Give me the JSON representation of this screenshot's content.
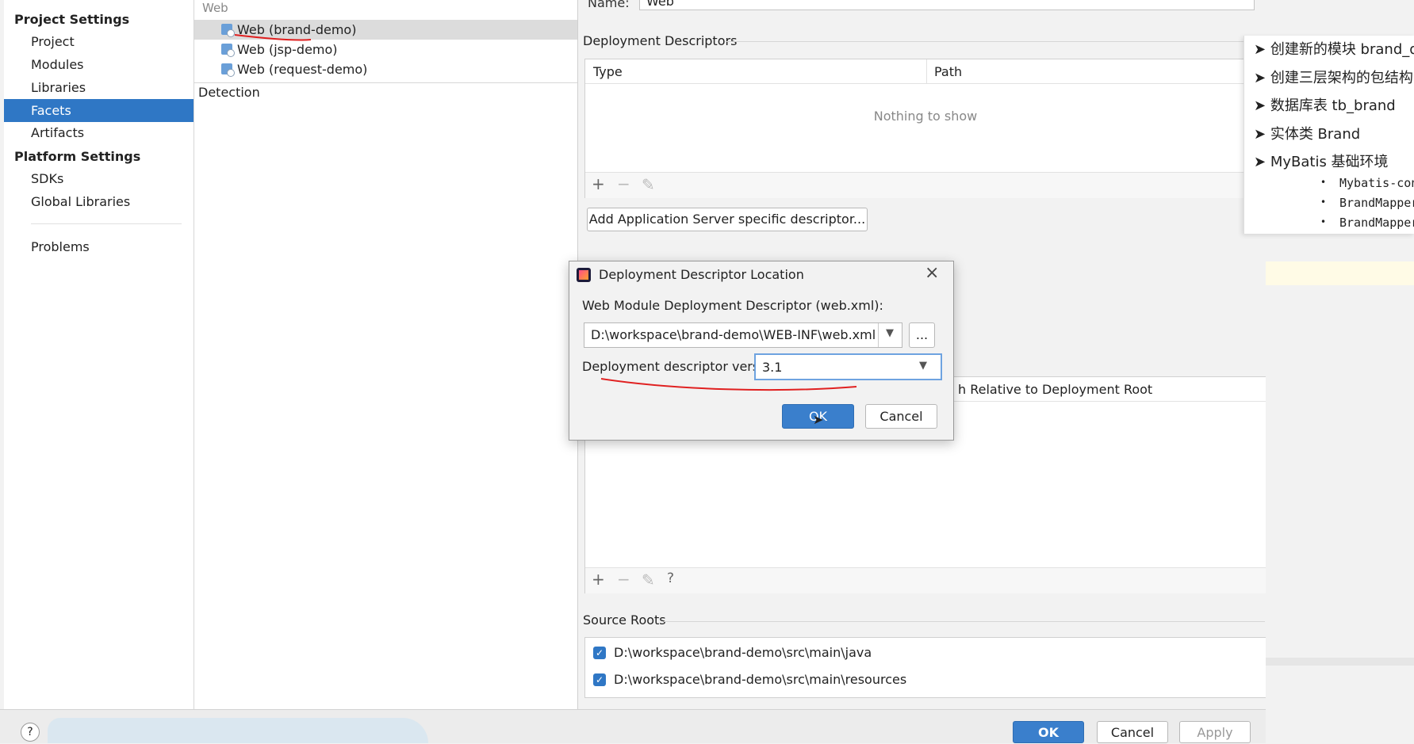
{
  "left_nav": {
    "project_settings_header": "Project Settings",
    "project_items": [
      "Project",
      "Modules",
      "Libraries",
      "Facets",
      "Artifacts"
    ],
    "platform_settings_header": "Platform Settings",
    "platform_items": [
      "SDKs",
      "Global Libraries"
    ],
    "problems": "Problems",
    "selected": "Facets"
  },
  "facets_tree": {
    "group": "Web",
    "items": [
      "Web (brand-demo)",
      "Web (jsp-demo)",
      "Web (request-demo)"
    ],
    "selected": "Web (brand-demo)",
    "detection": "Detection"
  },
  "facet_panel": {
    "name_label": "Name:",
    "name_value": "Web",
    "deployment_descriptors_title": "Deployment Descriptors",
    "columns": [
      "Type",
      "Path"
    ],
    "empty_text": "Nothing to show",
    "add_server_descriptor": "Add Application Server specific descriptor...",
    "web_resource_column_partial": "h Relative to Deployment Root",
    "source_roots_title": "Source Roots",
    "source_roots": [
      {
        "path": "D:\\workspace\\brand-demo\\src\\main\\java",
        "checked": true
      },
      {
        "path": "D:\\workspace\\brand-demo\\src\\main\\resources",
        "checked": true
      }
    ]
  },
  "dialog": {
    "title": "Deployment Descriptor Location",
    "descriptor_label": "Web Module Deployment Descriptor (web.xml):",
    "descriptor_path": "D:\\workspace\\brand-demo\\WEB-INF\\web.xml",
    "browse_label": "...",
    "version_label": "Deployment descriptor version",
    "version_value": "3.1",
    "ok_label": "OK",
    "cancel_label": "Cancel"
  },
  "bottom_bar": {
    "help": "?",
    "ok": "OK",
    "cancel": "Cancel",
    "apply": "Apply"
  },
  "notes": {
    "items": [
      "创建新的模块 brand_de",
      "创建三层架构的包结构",
      "数据库表 tb_brand",
      "实体类 Brand",
      "MyBatis 基础环境"
    ],
    "sub_items": [
      "Mybatis-con",
      "BrandMapper",
      "BrandMapper"
    ]
  },
  "colors": {
    "selection": "#2f77c5",
    "primary_button": "#3a7fcc",
    "annotation": "#e02020"
  }
}
